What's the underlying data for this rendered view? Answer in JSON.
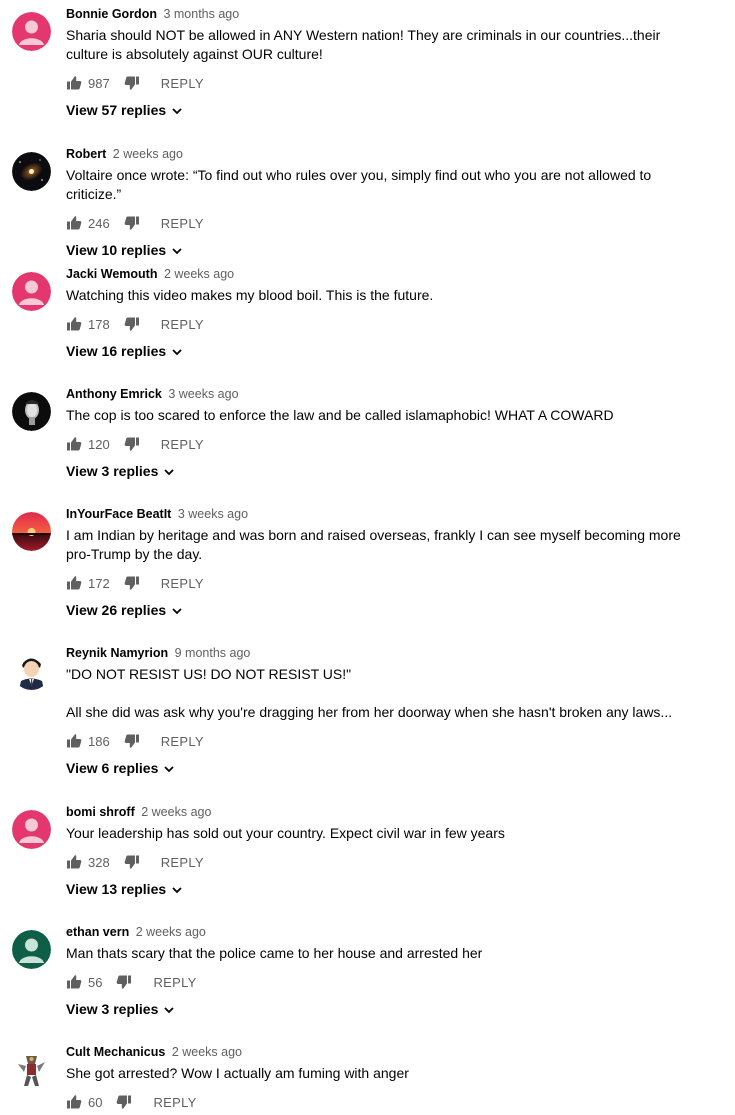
{
  "comments": [
    {
      "author": "Bonnie Gordon",
      "time": "3 months ago",
      "text": [
        "Sharia should NOT be allowed in ANY Western nation!  They are criminals in our countries...their culture is absolutely against OUR culture!"
      ],
      "likes": "987",
      "reply": "REPLY",
      "view_replies": "View 57 replies",
      "avatar": "default-pink"
    },
    {
      "author": "Robert",
      "time": "2 weeks ago",
      "text": [
        "Voltaire once wrote: “To find out who rules over you, simply find out who you are not allowed to criticize.”"
      ],
      "likes": "246",
      "reply": "REPLY",
      "view_replies": "View 10 replies",
      "avatar": "galaxy"
    },
    {
      "author": "Jacki Wemouth",
      "time": "2 weeks ago",
      "text": [
        "Watching this video makes my blood boil. This is the future."
      ],
      "likes": "178",
      "reply": "REPLY",
      "view_replies": "View 16 replies",
      "avatar": "default-pink"
    },
    {
      "author": "Anthony Emrick",
      "time": "3 weeks ago",
      "text": [
        "The cop is too scared to enforce the law and be called islamaphobic! WHAT A COWARD"
      ],
      "likes": "120",
      "reply": "REPLY",
      "view_replies": "View 3 replies",
      "avatar": "dark-face"
    },
    {
      "author": "InYourFace BeatIt",
      "time": "3 weeks ago",
      "text": [
        "I am Indian by heritage and was born and raised overseas, frankly I can see myself becoming more pro-Trump by the day."
      ],
      "likes": "172",
      "reply": "REPLY",
      "view_replies": "View 26 replies",
      "avatar": "sunset"
    },
    {
      "author": "Reynik Namyrion",
      "time": "9 months ago",
      "text": [
        "\"DO NOT RESIST US! DO NOT RESIST US!\"",
        "All she did was ask why you're dragging her from her doorway when she hasn't broken any laws..."
      ],
      "likes": "186",
      "reply": "REPLY",
      "view_replies": "View 6 replies",
      "avatar": "cartoon-man"
    },
    {
      "author": "bomi shroff",
      "time": "2 weeks ago",
      "text": [
        "Your leadership has sold out your country. Expect civil war in few years"
      ],
      "likes": "328",
      "reply": "REPLY",
      "view_replies": "View 13 replies",
      "avatar": "default-pink"
    },
    {
      "author": "ethan vern",
      "time": "2 weeks ago",
      "text": [
        "Man thats scary that the police came to her house and arrested her"
      ],
      "likes": "56",
      "reply": "REPLY",
      "view_replies": "View 3 replies",
      "avatar": "default-green"
    },
    {
      "author": "Cult Mechanicus",
      "time": "2 weeks ago",
      "text": [
        "She got arrested? Wow I actually am fuming with anger"
      ],
      "likes": "60",
      "reply": "REPLY",
      "view_replies": "",
      "avatar": "robot-figure"
    }
  ],
  "colors": {
    "pink_avatar": "#e4376f",
    "green_avatar": "#0f5e48",
    "text": "#030303",
    "meta": "#606060"
  }
}
